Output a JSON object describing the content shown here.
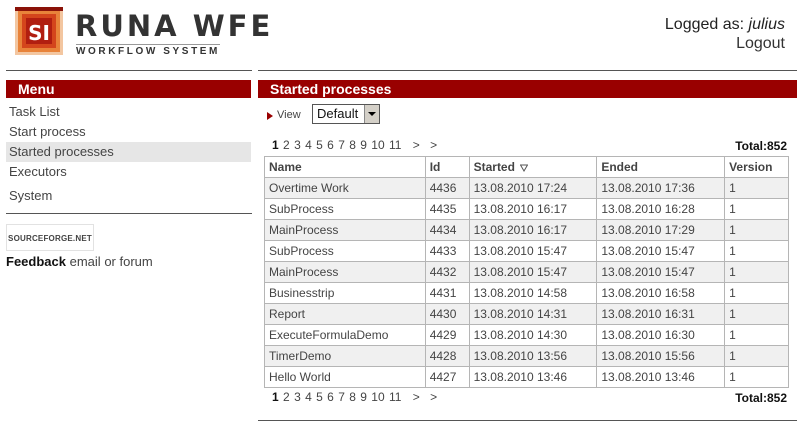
{
  "header": {
    "logo_text": "RUNA WFE",
    "logo_subtitle": "WORKFLOW SYSTEM",
    "logo_badge": "SI",
    "logged_as_label": "Logged as:",
    "user": "julius",
    "logout_label": "Logout"
  },
  "sidebar": {
    "title": "Menu",
    "items": [
      {
        "label": "Task List"
      },
      {
        "label": "Start process"
      },
      {
        "label": "Started processes"
      },
      {
        "label": "Executors"
      },
      {
        "label": "System"
      }
    ],
    "sourceforge_label": "SOURCEFORGE.NET",
    "feedback_label": "Feedback",
    "feedback_email": "email",
    "feedback_or": "or",
    "feedback_forum": "forum"
  },
  "main": {
    "title": "Started processes",
    "view_label": "View",
    "view_selected": "Default",
    "pager": {
      "pages": [
        "1",
        "2",
        "3",
        "4",
        "5",
        "6",
        "7",
        "8",
        "9",
        "10",
        "11"
      ],
      "current": "1",
      "next": ">",
      "last": ">"
    },
    "total_label": "Total:852",
    "columns": [
      "Name",
      "Id",
      "Started",
      "Ended",
      "Version"
    ],
    "rows": [
      {
        "name": "Overtime Work",
        "id": "4436",
        "started": "13.08.2010 17:24",
        "ended": "13.08.2010 17:36",
        "version": "1"
      },
      {
        "name": "SubProcess",
        "id": "4435",
        "started": "13.08.2010 16:17",
        "ended": "13.08.2010 16:28",
        "version": "1"
      },
      {
        "name": "MainProcess",
        "id": "4434",
        "started": "13.08.2010 16:17",
        "ended": "13.08.2010 17:29",
        "version": "1"
      },
      {
        "name": "SubProcess",
        "id": "4433",
        "started": "13.08.2010 15:47",
        "ended": "13.08.2010 15:47",
        "version": "1"
      },
      {
        "name": "MainProcess",
        "id": "4432",
        "started": "13.08.2010 15:47",
        "ended": "13.08.2010 15:47",
        "version": "1"
      },
      {
        "name": "Businesstrip",
        "id": "4431",
        "started": "13.08.2010 14:58",
        "ended": "13.08.2010 16:58",
        "version": "1"
      },
      {
        "name": "Report",
        "id": "4430",
        "started": "13.08.2010 14:31",
        "ended": "13.08.2010 16:31",
        "version": "1"
      },
      {
        "name": "ExecuteFormulaDemo",
        "id": "4429",
        "started": "13.08.2010 14:30",
        "ended": "13.08.2010 16:30",
        "version": "1"
      },
      {
        "name": "TimerDemo",
        "id": "4428",
        "started": "13.08.2010 13:56",
        "ended": "13.08.2010 15:56",
        "version": "1"
      },
      {
        "name": "Hello World",
        "id": "4427",
        "started": "13.08.2010 13:46",
        "ended": "13.08.2010 13:46",
        "version": "1"
      }
    ]
  },
  "colors": {
    "accent": "#990000",
    "row_alt": "#f0f0f0",
    "active_menu": "#e6e6e6"
  },
  "icons": [
    "runa-logo-icon",
    "view-arrow-icon",
    "dropdown-arrow-icon",
    "sort-desc-icon"
  ]
}
